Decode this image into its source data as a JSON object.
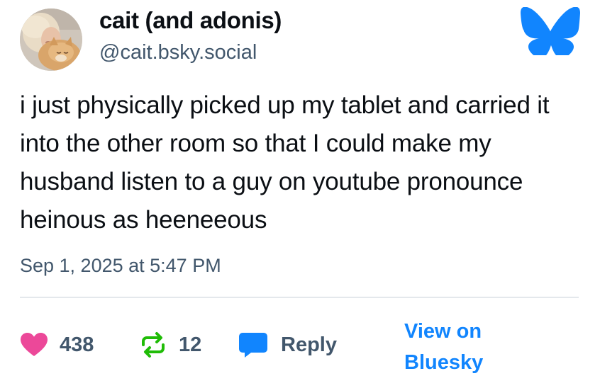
{
  "author": {
    "display_name": "cait (and adonis)",
    "handle": "@cait.bsky.social"
  },
  "post": {
    "text": "i just physically picked up my tablet and carried it into the other room so that I could make my husband listen to a guy on youtube pronounce heinous as heeneeous",
    "timestamp": "Sep 1, 2025 at 5:47 PM"
  },
  "actions": {
    "likes": "438",
    "reposts": "12",
    "reply_label": "Reply",
    "view_line1": "View on",
    "view_line2": "Bluesky"
  },
  "icons": {
    "logo": "bluesky-butterfly-icon",
    "like": "heart-icon",
    "repost": "repost-icon",
    "reply": "speech-bubble-icon"
  },
  "colors": {
    "brand_blue": "#1185fe",
    "heart_pink": "#ec4899",
    "repost_green": "#20bc07",
    "muted_text": "#42576c"
  }
}
